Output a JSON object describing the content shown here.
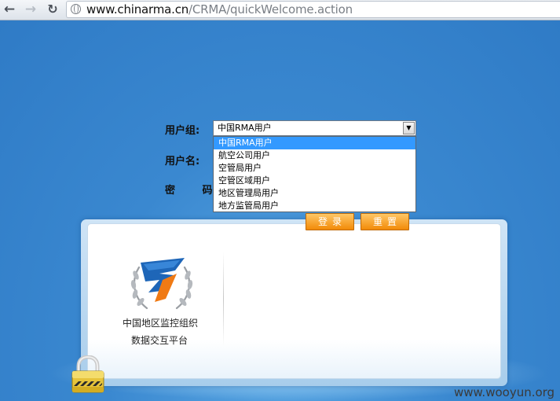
{
  "browser": {
    "url_host": "www.chinarma.cn",
    "url_path": "/CRMA/quickWelcome.action",
    "back_icon": "arrow-left",
    "forward_icon": "arrow-right",
    "reload_icon": "reload"
  },
  "form": {
    "group_label": "用户组:",
    "user_label": "用户名:",
    "pass_label": "密 码:",
    "select": {
      "value": "中国RMA用户",
      "options": [
        "中国RMA用户",
        "航空公司用户",
        "空管局用户",
        "空管区域用户",
        "地区管理局用户",
        "地方监管局用户"
      ],
      "selected_index": 0
    },
    "login_button": "登录",
    "reset_button": "重置"
  },
  "panel": {
    "org_line1": "中国地区监控组织",
    "org_line2": "数据交互平台"
  },
  "watermark": "www.wooyun.org",
  "colors": {
    "page_bg": "#3a86cf",
    "button_orange": "#f28a08",
    "option_highlight": "#3399ff"
  }
}
